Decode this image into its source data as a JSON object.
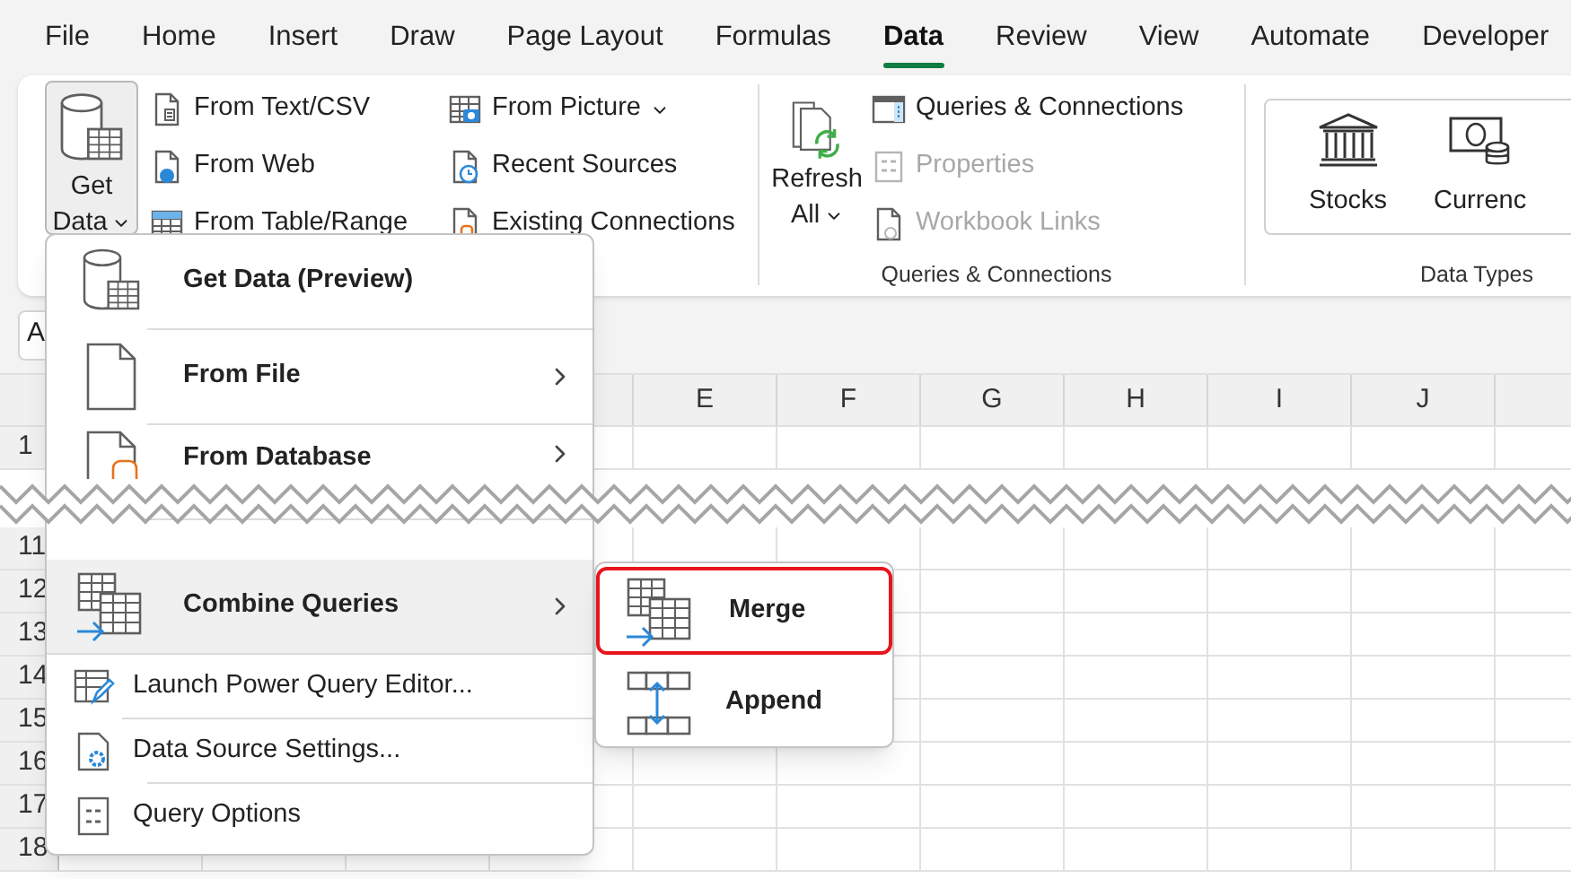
{
  "tabs": [
    {
      "label": "File",
      "selected": false
    },
    {
      "label": "Home",
      "selected": false
    },
    {
      "label": "Insert",
      "selected": false
    },
    {
      "label": "Draw",
      "selected": false
    },
    {
      "label": "Page Layout",
      "selected": false
    },
    {
      "label": "Formulas",
      "selected": false
    },
    {
      "label": "Data",
      "selected": true
    },
    {
      "label": "Review",
      "selected": false
    },
    {
      "label": "View",
      "selected": false
    },
    {
      "label": "Automate",
      "selected": false
    },
    {
      "label": "Developer",
      "selected": false
    }
  ],
  "ribbon": {
    "get_transform": {
      "big_button": {
        "lines": [
          "Get",
          "Data"
        ],
        "dropdown": true,
        "pressed": true
      },
      "columns": [
        [
          {
            "label": "From Text/CSV",
            "dropdown": false,
            "disabled": false
          },
          {
            "label": "From Web",
            "dropdown": false,
            "disabled": false
          },
          {
            "label": "From Table/Range",
            "dropdown": false,
            "disabled": false
          }
        ],
        [
          {
            "label": "From Picture",
            "dropdown": true,
            "disabled": false
          },
          {
            "label": "Recent Sources",
            "dropdown": false,
            "disabled": false
          },
          {
            "label": "Existing Connections",
            "dropdown": false,
            "disabled": false
          }
        ]
      ]
    },
    "queries": {
      "label": "Queries & Connections",
      "big_button": {
        "lines": [
          "Refresh",
          "All"
        ],
        "dropdown": true,
        "pressed": false
      },
      "items": [
        {
          "label": "Queries & Connections",
          "disabled": false
        },
        {
          "label": "Properties",
          "disabled": true
        },
        {
          "label": "Workbook Links",
          "disabled": true
        }
      ]
    },
    "data_types": {
      "label": "Data Types",
      "gallery": [
        "Stocks",
        "Currenc"
      ]
    }
  },
  "name_box": "A",
  "sheet": {
    "columns": [
      "E",
      "F",
      "G",
      "H",
      "I",
      "J"
    ],
    "rows": [
      "1",
      "11",
      "12",
      "13",
      "14",
      "15",
      "16",
      "17",
      "18"
    ]
  },
  "menu": {
    "items": [
      {
        "label": "Get Data (Preview)",
        "kind": "large",
        "submenu": false,
        "selected": false
      },
      {
        "label": "From File",
        "kind": "large",
        "submenu": true,
        "selected": false
      },
      {
        "label": "From Database",
        "kind": "large",
        "submenu": true,
        "selected": false
      },
      {
        "label": "Combine Queries",
        "kind": "large",
        "submenu": true,
        "selected": true
      },
      {
        "label": "Launch Power Query Editor...",
        "kind": "small",
        "submenu": false,
        "selected": false
      },
      {
        "label": "Data Source Settings...",
        "kind": "small",
        "submenu": false,
        "selected": false
      },
      {
        "label": "Query Options",
        "kind": "small",
        "submenu": false,
        "selected": false
      }
    ]
  },
  "submenu": {
    "items": [
      {
        "label": "Merge",
        "selected": true
      },
      {
        "label": "Append",
        "selected": false
      }
    ]
  }
}
